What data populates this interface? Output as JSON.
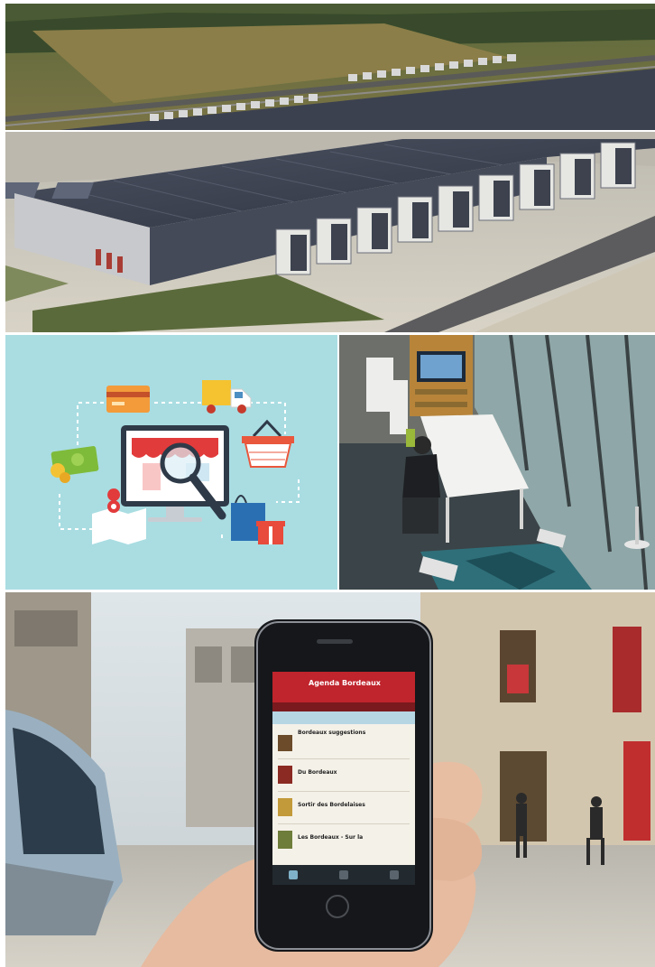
{
  "photo_grid": {
    "panels": [
      {
        "subject": "aerial-data-center"
      },
      {
        "subject": "ecommerce-illustration"
      },
      {
        "subject": "coworking-office"
      },
      {
        "subject": "hand-holding-smartphone-street"
      }
    ]
  },
  "phone_screen": {
    "app_title": "Agenda Bordeaux",
    "rows": [
      "Bordeaux suggestions",
      "Du Bordeaux",
      "Sortir des Bordelaises",
      "Les Bordeaux - Sur la"
    ]
  },
  "colors": {
    "ecom_background": "#a9dde2",
    "sky": "#cfdbe2",
    "roof": "#3b4150",
    "field": "#6a6a3a",
    "phone_header": "#c0242c",
    "store_awning": "#e23b3b"
  }
}
